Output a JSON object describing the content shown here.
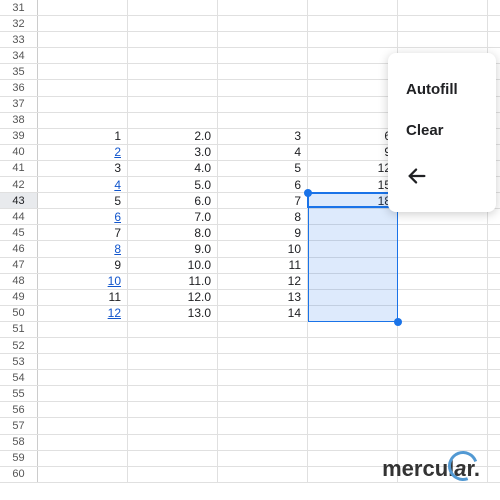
{
  "rows": {
    "start": 31,
    "end": 60,
    "activeRow": 43
  },
  "columns": {
    "B": {
      "39": "1",
      "40": "2",
      "41": "3",
      "42": "4",
      "43": "5",
      "44": "6",
      "45": "7",
      "46": "8",
      "47": "9",
      "48": "10",
      "49": "11",
      "50": "12",
      "linkRows": [
        40,
        42,
        44,
        46,
        48,
        50
      ]
    },
    "C": {
      "39": "2.0",
      "40": "3.0",
      "41": "4.0",
      "42": "5.0",
      "43": "6.0",
      "44": "7.0",
      "45": "8.0",
      "46": "9.0",
      "47": "10.0",
      "48": "11.0",
      "49": "12.0",
      "50": "13.0"
    },
    "D": {
      "39": "3",
      "40": "4",
      "41": "5",
      "42": "6",
      "43": "7",
      "44": "8",
      "45": "9",
      "46": "10",
      "47": "11",
      "48": "12",
      "49": "13",
      "50": "14"
    },
    "E": {
      "39": "6",
      "40": "9",
      "41": "12",
      "42": "15",
      "43": "18"
    }
  },
  "selection": {
    "startRow": 43,
    "endRow": 50,
    "col": "E"
  },
  "activeCell": {
    "row": 43,
    "col": "E"
  },
  "menu": {
    "items": [
      "Autofill",
      "Clear"
    ],
    "back": "←"
  },
  "watermark": {
    "text_before": "mercul",
    "text_o": "a",
    "text_after": "r."
  }
}
